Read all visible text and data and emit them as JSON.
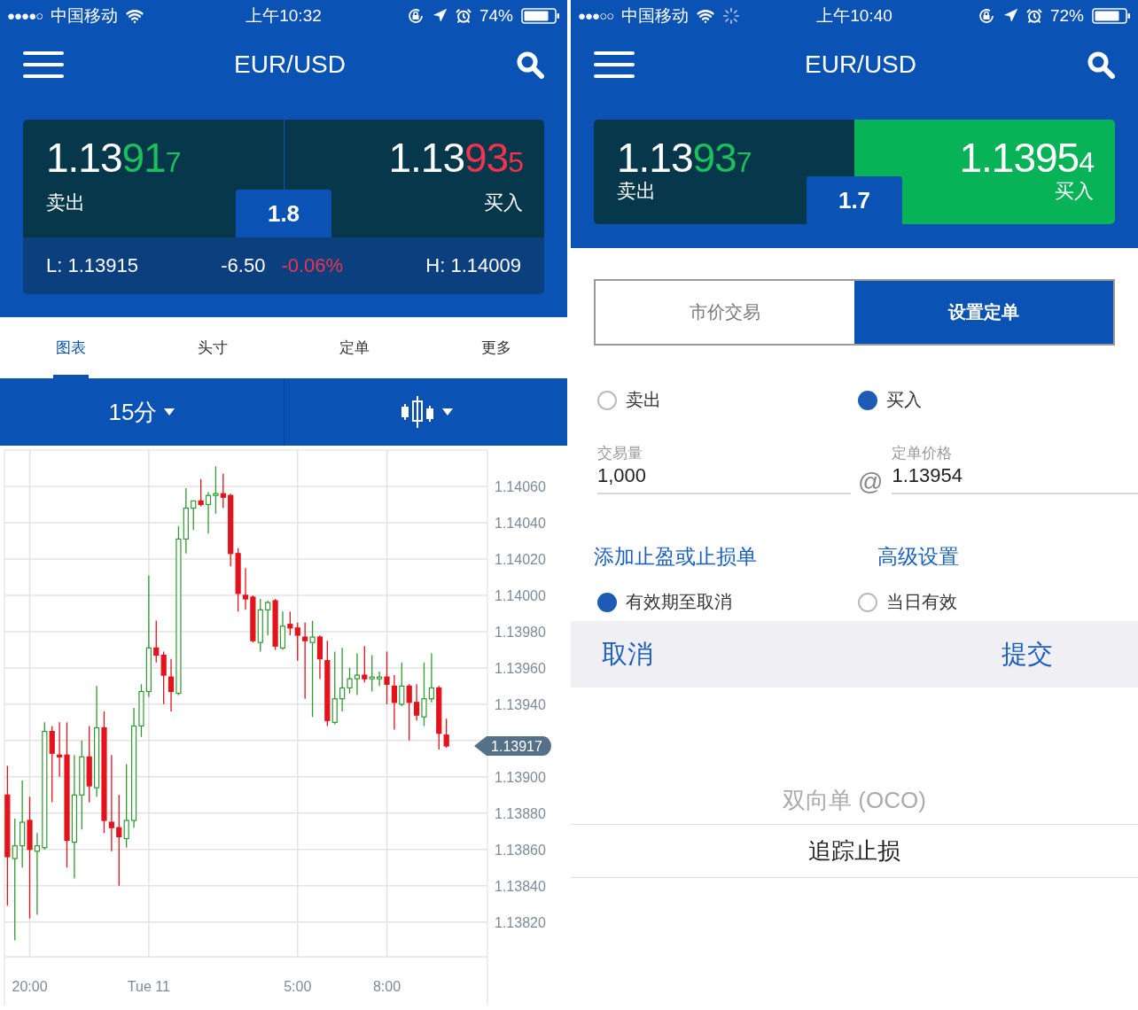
{
  "phones": [
    {
      "kind": "chart",
      "status": {
        "signal": "●●●●○",
        "carrier": "中国移动",
        "loading": false,
        "time": "上午10:32",
        "battery": "74%"
      },
      "title": "EUR/USD",
      "quote": {
        "sell": {
          "label": "卖出",
          "big": "1.13",
          "pips": "91",
          "fraction": "7",
          "color": "#1cbf5c",
          "highlighted": false
        },
        "buy": {
          "label": "买入",
          "big": "1.13",
          "pips": "93",
          "fraction": "5",
          "color": "#f0344e",
          "highlighted": false
        },
        "spread": "1.8",
        "stats": {
          "low": "L: 1.13915",
          "change": "-6.50",
          "change_pct": "-0.06%",
          "high": "H: 1.14009"
        }
      },
      "tabs": [
        {
          "label": "图表",
          "selected": true
        },
        {
          "label": "头寸",
          "selected": false
        },
        {
          "label": "定单",
          "selected": false
        },
        {
          "label": "更多",
          "selected": false
        }
      ],
      "toolbar": {
        "interval": "15分"
      },
      "chart": {
        "price_tag": "1.13917",
        "chart_data": {
          "type": "candlestick",
          "grid": true,
          "ylim": [
            1.13774,
            1.1408
          ],
          "categories": [
            null,
            null,
            null,
            "20:00",
            null,
            null,
            null,
            null,
            null,
            null,
            null,
            null,
            null,
            null,
            null,
            null,
            null,
            null,
            null,
            "Tue 11",
            null,
            null,
            null,
            null,
            null,
            null,
            null,
            null,
            null,
            null,
            null,
            null,
            null,
            null,
            null,
            null,
            null,
            null,
            null,
            "5:00",
            null,
            null,
            null,
            null,
            null,
            null,
            null,
            null,
            null,
            null,
            null,
            "8:00",
            null,
            null,
            null,
            null,
            null,
            null,
            null,
            null
          ],
          "yticks": [
            {
              "value": 1.1382,
              "label": "1.13820"
            },
            {
              "value": 1.1384,
              "label": "1.13840"
            },
            {
              "value": 1.1386,
              "label": "1.13860"
            },
            {
              "value": 1.1388,
              "label": "1.13880"
            },
            {
              "value": 1.139,
              "label": "1.13900"
            },
            {
              "value": 1.1394,
              "label": "1.13940"
            },
            {
              "value": 1.1396,
              "label": "1.13960"
            },
            {
              "value": 1.1398,
              "label": "1.13980"
            },
            {
              "value": 1.14,
              "label": "1.14000"
            },
            {
              "value": 1.1402,
              "label": "1.14020"
            },
            {
              "value": 1.1404,
              "label": "1.14040"
            },
            {
              "value": 1.1406,
              "label": "1.14060"
            }
          ],
          "series": [
            {
              "ohlc": [
                [
                  1.1389,
                  1.13906,
                  1.13829,
                  1.13856
                ],
                [
                  1.13855,
                  1.13877,
                  1.1381,
                  1.13862
                ],
                [
                  1.13862,
                  1.13898,
                  1.1385,
                  1.13875
                ],
                [
                  1.13876,
                  1.13889,
                  1.13822,
                  1.1386
                ],
                [
                  1.13859,
                  1.13869,
                  1.13824,
                  1.13862
                ],
                [
                  1.13861,
                  1.1393,
                  1.1386,
                  1.13925
                ],
                [
                  1.13925,
                  1.13928,
                  1.13886,
                  1.13913
                ],
                [
                  1.13912,
                  1.1393,
                  1.139,
                  1.13911
                ],
                [
                  1.13912,
                  1.1393,
                  1.1385,
                  1.13865
                ],
                [
                  1.13864,
                  1.13912,
                  1.13844,
                  1.1389
                ],
                [
                  1.1389,
                  1.1392,
                  1.13871,
                  1.13911
                ],
                [
                  1.13911,
                  1.13928,
                  1.13886,
                  1.13895
                ],
                [
                  1.13894,
                  1.1395,
                  1.13889,
                  1.13927
                ],
                [
                  1.13927,
                  1.13936,
                  1.13869,
                  1.13876
                ],
                [
                  1.13875,
                  1.13912,
                  1.13859,
                  1.13872
                ],
                [
                  1.13872,
                  1.1389,
                  1.1384,
                  1.13867
                ],
                [
                  1.13866,
                  1.13907,
                  1.13861,
                  1.13876
                ],
                [
                  1.13876,
                  1.13938,
                  1.13872,
                  1.13928
                ],
                [
                  1.13928,
                  1.13951,
                  1.13922,
                  1.13947
                ],
                [
                  1.13947,
                  1.14011,
                  1.13944,
                  1.13971
                ],
                [
                  1.13971,
                  1.13986,
                  1.13963,
                  1.13967
                ],
                [
                  1.13967,
                  1.13969,
                  1.1394,
                  1.13956
                ],
                [
                  1.13955,
                  1.13965,
                  1.13936,
                  1.13947
                ],
                [
                  1.13946,
                  1.14038,
                  1.13945,
                  1.14031
                ],
                [
                  1.14031,
                  1.14059,
                  1.14023,
                  1.14048
                ],
                [
                  1.14048,
                  1.14052,
                  1.14036,
                  1.14052
                ],
                [
                  1.14052,
                  1.14064,
                  1.14049,
                  1.1405
                ],
                [
                  1.1405,
                  1.14057,
                  1.14034,
                  1.14055
                ],
                [
                  1.14055,
                  1.14071,
                  1.14045,
                  1.14056
                ],
                [
                  1.14056,
                  1.14067,
                  1.14048,
                  1.14054
                ],
                [
                  1.14055,
                  1.14056,
                  1.14016,
                  1.14023
                ],
                [
                  1.14023,
                  1.14026,
                  1.13991,
                  1.14001
                ],
                [
                  1.14,
                  1.14015,
                  1.13992,
                  1.13998
                ],
                [
                  1.13999,
                  1.14,
                  1.13974,
                  1.13975
                ],
                [
                  1.13974,
                  1.13998,
                  1.13969,
                  1.13992
                ],
                [
                  1.13992,
                  1.13997,
                  1.13978,
                  1.13996
                ],
                [
                  1.13997,
                  1.13998,
                  1.1397,
                  1.13972
                ],
                [
                  1.13971,
                  1.13991,
                  1.1397,
                  1.13983
                ],
                [
                  1.13984,
                  1.13991,
                  1.13978,
                  1.13982
                ],
                [
                  1.13982,
                  1.13985,
                  1.13964,
                  1.13978
                ],
                [
                  1.13977,
                  1.13985,
                  1.13943,
                  1.13975
                ],
                [
                  1.13974,
                  1.13986,
                  1.13933,
                  1.13977
                ],
                [
                  1.13977,
                  1.13978,
                  1.13954,
                  1.13965
                ],
                [
                  1.13964,
                  1.13975,
                  1.13928,
                  1.13931
                ],
                [
                  1.1393,
                  1.13969,
                  1.13929,
                  1.13943
                ],
                [
                  1.13943,
                  1.13971,
                  1.13936,
                  1.13949
                ],
                [
                  1.13949,
                  1.1396,
                  1.13946,
                  1.13954
                ],
                [
                  1.13954,
                  1.13968,
                  1.13945,
                  1.13956
                ],
                [
                  1.13956,
                  1.13972,
                  1.13952,
                  1.13954
                ],
                [
                  1.13954,
                  1.13967,
                  1.13947,
                  1.13955
                ],
                [
                  1.13954,
                  1.13958,
                  1.1395,
                  1.13955
                ],
                [
                  1.13955,
                  1.13969,
                  1.1394,
                  1.13951
                ],
                [
                  1.1395,
                  1.13956,
                  1.13926,
                  1.13941
                ],
                [
                  1.1394,
                  1.13963,
                  1.13939,
                  1.1395
                ],
                [
                  1.1395,
                  1.13951,
                  1.1392,
                  1.13941
                ],
                [
                  1.13941,
                  1.13951,
                  1.13931,
                  1.13934
                ],
                [
                  1.13933,
                  1.13963,
                  1.13928,
                  1.13943
                ],
                [
                  1.13943,
                  1.13968,
                  1.13941,
                  1.13949
                ],
                [
                  1.13949,
                  1.1395,
                  1.13915,
                  1.13924
                ],
                [
                  1.13923,
                  1.13932,
                  1.13916,
                  1.13917
                ]
              ]
            }
          ]
        }
      }
    },
    {
      "kind": "order",
      "status": {
        "signal": "●●●○○",
        "carrier": "中国移动",
        "loading": true,
        "time": "上午10:40",
        "battery": "72%"
      },
      "title": "EUR/USD",
      "quote": {
        "sell": {
          "label": "卖出",
          "big": "1.13",
          "pips": "93",
          "fraction": "7",
          "color": "#1cbf5c",
          "highlighted": false
        },
        "buy": {
          "label": "买入",
          "big": "1.13",
          "pips": "95",
          "fraction": "4",
          "color": "#ffffff",
          "highlighted": true
        },
        "spread": "1.7"
      },
      "order_type_tabs": [
        {
          "label": "市价交易",
          "selected": false
        },
        {
          "label": "设置定单",
          "selected": true
        }
      ],
      "direction": [
        {
          "label": "卖出",
          "selected": false
        },
        {
          "label": "买入",
          "selected": true
        }
      ],
      "fields": [
        {
          "label": "交易量",
          "value": "1,000"
        },
        {
          "label": "定单价格",
          "prefix": "@",
          "value": "1.13954"
        }
      ],
      "links": [
        "添加止盈或止损单",
        "高级设置"
      ],
      "expiry": [
        {
          "label": "有效期至取消",
          "selected": true
        },
        {
          "label": "当日有效",
          "selected": false
        }
      ],
      "actions": {
        "cancel": "取消",
        "submit": "提交"
      },
      "picker": [
        {
          "label": "双向单 (OCO)",
          "selected": false
        },
        {
          "label": "追踪止损",
          "selected": true
        }
      ]
    }
  ]
}
